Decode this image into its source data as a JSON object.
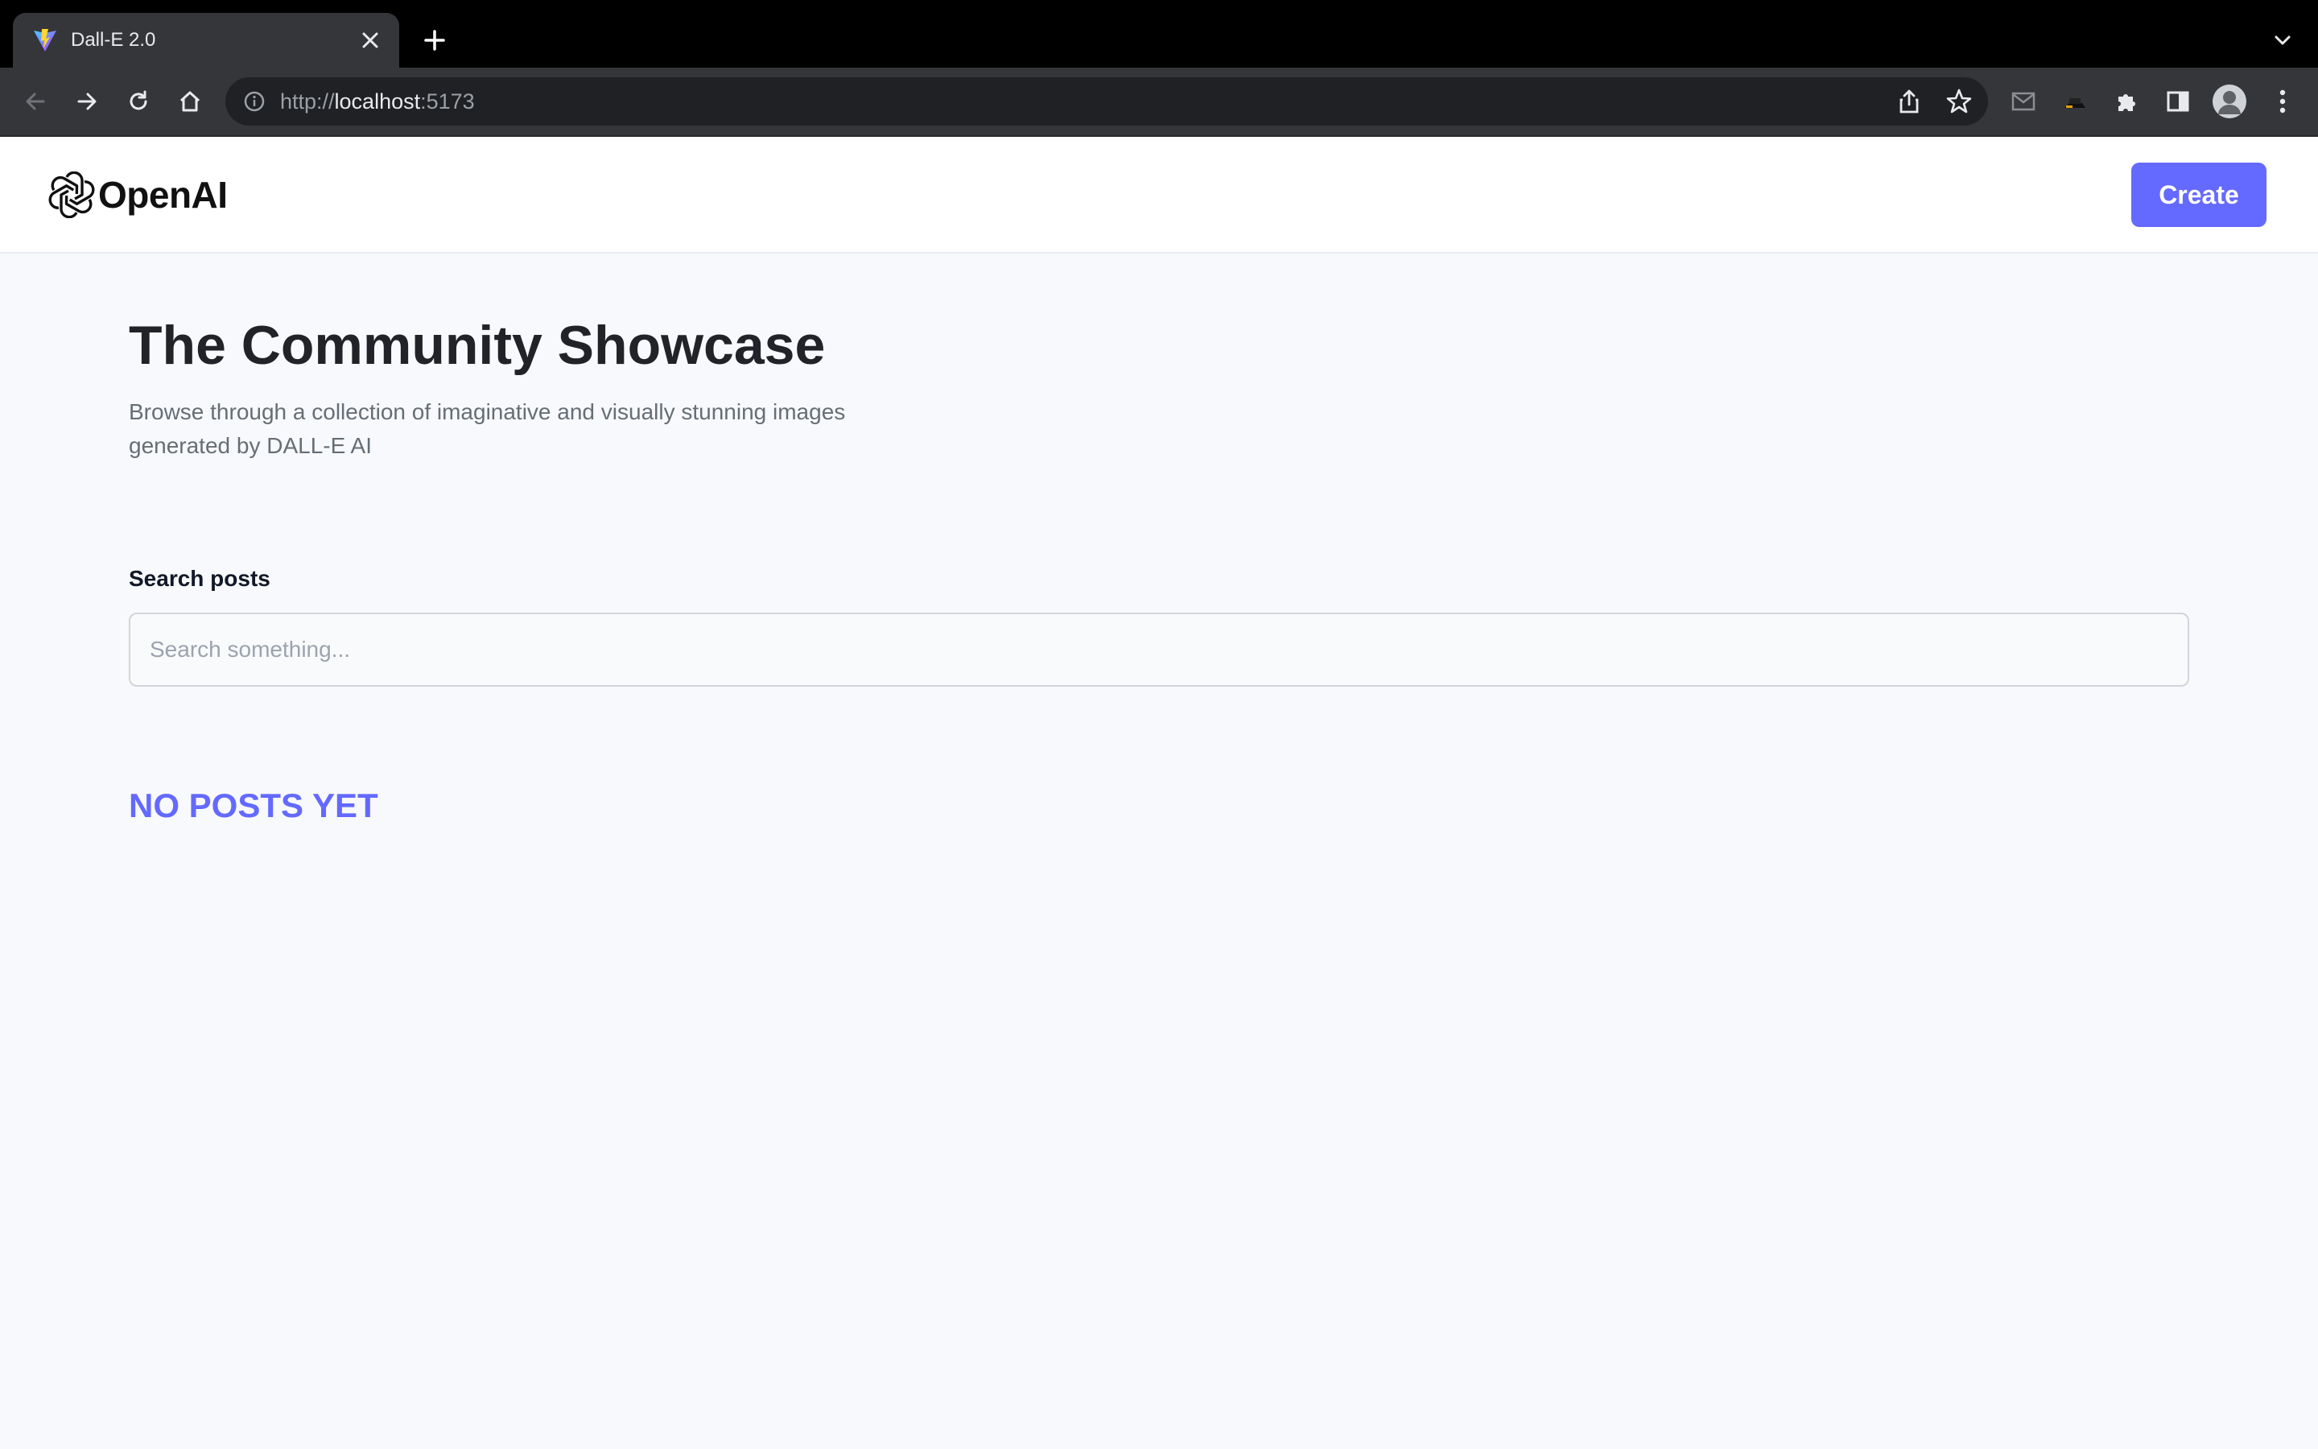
{
  "browser": {
    "tab": {
      "title": "Dall-E 2.0"
    },
    "address_bar": {
      "scheme": "http://",
      "host": "localhost",
      "port": ":5173"
    }
  },
  "header": {
    "logo_text": "OpenAI",
    "create_label": "Create"
  },
  "main": {
    "title": "The Community Showcase",
    "subtitle": "Browse through a collection of imaginative and visually stunning images generated by DALL-E AI",
    "search": {
      "label": "Search posts",
      "placeholder": "Search something...",
      "value": ""
    },
    "empty_message": "NO POSTS YET"
  },
  "colors": {
    "accent": "#6469ff",
    "page_background": "#f8f9fc",
    "title_text": "#222328",
    "subtitle_text": "#666e75"
  }
}
